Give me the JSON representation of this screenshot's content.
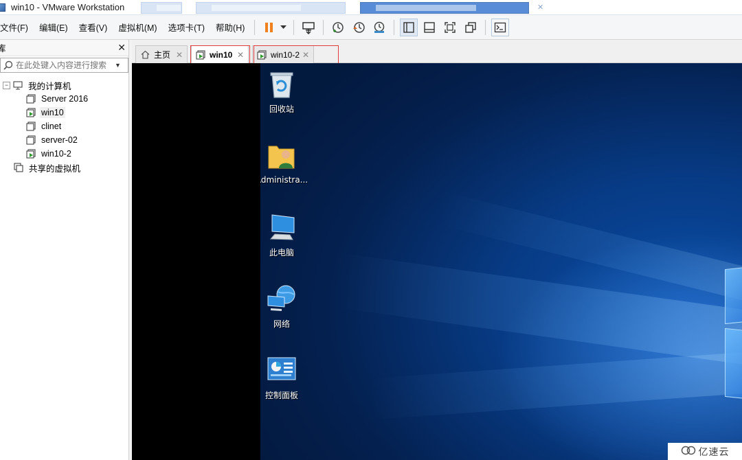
{
  "window": {
    "title": "win10 - VMware Workstation"
  },
  "menu": {
    "file": "文件(F)",
    "edit": "编辑(E)",
    "view": "查看(V)",
    "vm": "虚拟机(M)",
    "tabs": "选项卡(T)",
    "help": "帮助(H)"
  },
  "toolbar": {
    "icons": [
      "pause-icon",
      "dropdown-icon",
      "send-ctrl-alt-del-icon",
      "snapshot-icon",
      "revert-snapshot-icon",
      "snapshot-manager-icon",
      "library-view-icon",
      "thumbnail-bar-icon",
      "fullscreen-icon",
      "unity-icon",
      "console-icon"
    ],
    "accent": "#f07f1e"
  },
  "library": {
    "title": "库",
    "search_placeholder": "在此处键入内容进行搜索",
    "root_label": "我的计算机",
    "items": [
      {
        "label": "Server 2016",
        "running": false
      },
      {
        "label": "win10",
        "running": true
      },
      {
        "label": "clinet",
        "running": false
      },
      {
        "label": "server-02",
        "running": false
      },
      {
        "label": "win10-2",
        "running": true
      }
    ],
    "shared_label": "共享的虚拟机"
  },
  "tabs": [
    {
      "label": "主页",
      "active": false
    },
    {
      "label": "win10",
      "active": true
    },
    {
      "label": "win10-2",
      "active": false
    }
  ],
  "desktop": {
    "icons": [
      {
        "label": "回收站",
        "icon": "recycle-bin-icon"
      },
      {
        "label": "Administra...",
        "icon": "user-folder-icon"
      },
      {
        "label": "此电脑",
        "icon": "this-pc-icon"
      },
      {
        "label": "网络",
        "icon": "network-icon"
      },
      {
        "label": "控制面板",
        "icon": "control-panel-icon"
      }
    ]
  },
  "watermark": {
    "text": "亿速云"
  },
  "colors": {
    "highlight_box": "#e23b3b",
    "desktop_blue": "#0a4ea8"
  }
}
